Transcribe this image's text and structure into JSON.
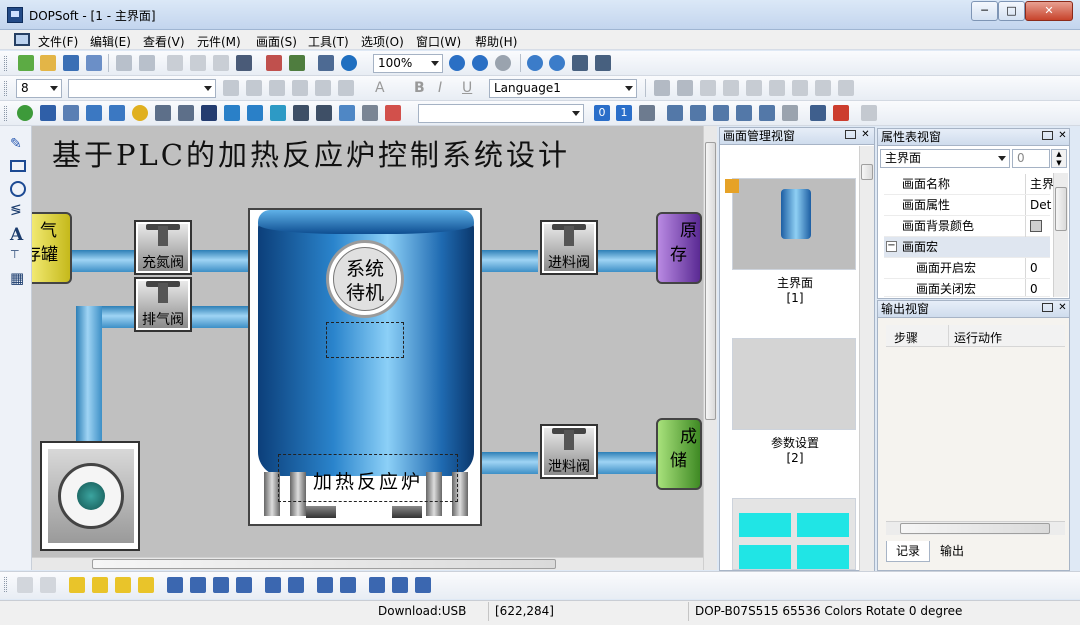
{
  "window": {
    "title": "DOPSoft - [1 - 主界面]",
    "min_label": "─",
    "max_label": "□",
    "close_label": "✕"
  },
  "menu": [
    "文件(F)",
    "编辑(E)",
    "查看(V)",
    "元件(M)",
    "画面(S)",
    "工具(T)",
    "选项(O)",
    "窗口(W)",
    "帮助(H)"
  ],
  "toolbar": {
    "zoom": "100%",
    "font_size": "8",
    "language": "Language1",
    "text_bold": "B",
    "text_italic": "I",
    "text_underline": "U",
    "text_color": "A",
    "num_0": "0",
    "num_1": "1"
  },
  "canvas": {
    "page_title": "基于PLC的加热反应炉控制系统设计",
    "valve_nitrogen": "充氮阀",
    "valve_exhaust": "排气阀",
    "valve_feed_in": "进料阀",
    "valve_feed_out": "泄料阀",
    "tank_gas_line1": "气",
    "tank_gas_line2": "存罐",
    "tank_raw_line1": "原",
    "tank_raw_line2": "存",
    "tank_prod_line1": "成",
    "tank_prod_line2": "储",
    "status_line1": "系统",
    "status_line2": "待机",
    "reactor_label": "加热反应炉"
  },
  "screens_panel": {
    "title": "画面管理视窗",
    "screens": [
      {
        "name": "主界面",
        "id": "[1]"
      },
      {
        "name": "参数设置",
        "id": "[2]"
      }
    ]
  },
  "props_panel": {
    "title": "属性表视窗",
    "selected_object": "主界面",
    "spin_value": "0",
    "rows": [
      {
        "key": "画面名称",
        "value": "主界",
        "indent": false
      },
      {
        "key": "画面属性",
        "value": "Det",
        "indent": false
      },
      {
        "key": "画面背景颜色",
        "value": "",
        "indent": false
      },
      {
        "key": "画面宏",
        "value": "",
        "indent": false
      },
      {
        "key": "画面开启宏",
        "value": "0",
        "indent": true
      },
      {
        "key": "画面关闭宏",
        "value": "0",
        "indent": true
      }
    ],
    "bg_color": "#cfcfcf"
  },
  "output_panel": {
    "title": "输出视窗",
    "col_step": "步骤",
    "col_action": "运行动作",
    "tabs": [
      "记录",
      "输出"
    ]
  },
  "status": {
    "download": "Download:USB",
    "coords": "[622,284]",
    "device": "DOP-B07S515 65536 Colors Rotate 0 degree"
  },
  "colors": {
    "pipe": "#5fb0e2",
    "reactor": "#2a84cc",
    "gas_tank": "#d8d020",
    "raw_tank": "#7b3db3",
    "product_tank": "#61b43a"
  }
}
